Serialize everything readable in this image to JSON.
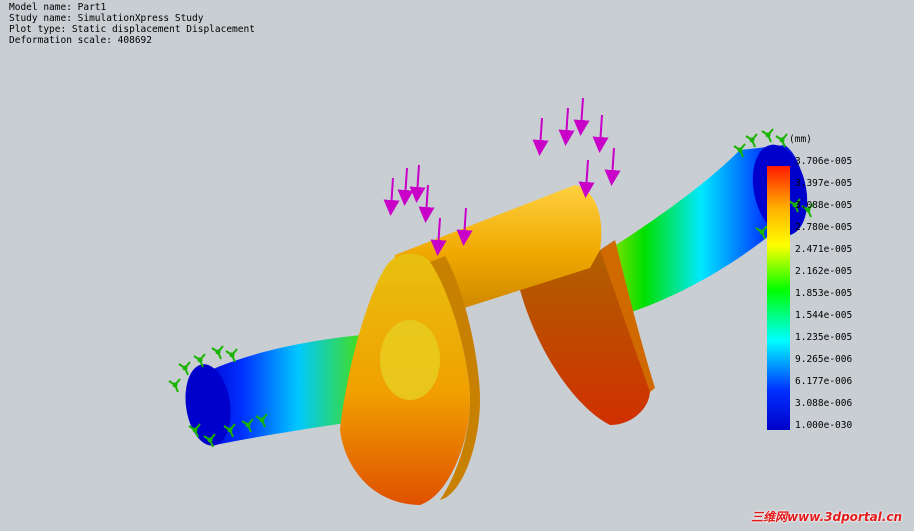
{
  "study_info": {
    "model_name": "Model name: Part1",
    "study_name": "Study name: SimulationXpress Study",
    "plot_type": "Plot type: Static displacement Displacement",
    "deformation_scale": "Deformation scale: 408692"
  },
  "legend": {
    "units": "(mm)",
    "ticks": [
      "3.706e-005",
      "3.397e-005",
      "3.088e-005",
      "2.780e-005",
      "2.471e-005",
      "2.162e-005",
      "1.853e-005",
      "1.544e-005",
      "1.235e-005",
      "9.265e-006",
      "6.177e-006",
      "3.088e-006",
      "1.000e-030"
    ],
    "colors": [
      "#ff1a00",
      "#ffb000",
      "#ffff00",
      "#00ff00",
      "#00ffff",
      "#0030ff",
      "#0000c8"
    ]
  },
  "watermark": "三维网www.3dportal.cn",
  "colors": {
    "background": "#c9ced3",
    "load_arrow": "#c800c8",
    "fixture": "#19b400"
  }
}
